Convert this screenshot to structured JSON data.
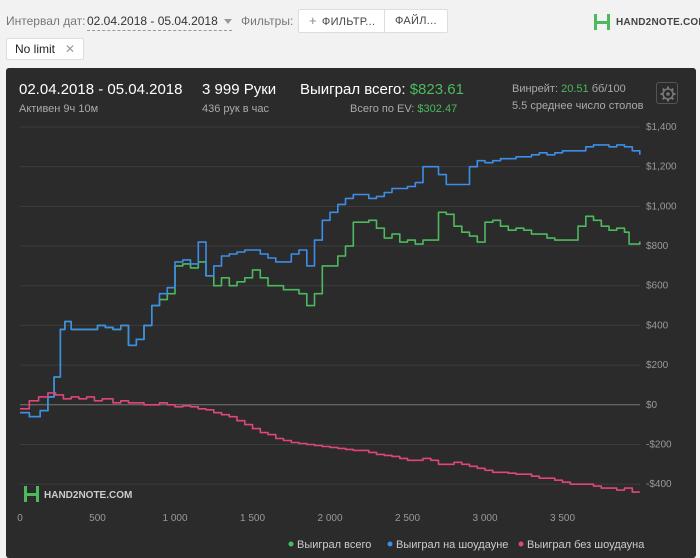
{
  "toolbar": {
    "date_label": "Интервал дат:",
    "date_value": "02.04.2018 - 05.04.2018",
    "filters_label": "Фильтры:",
    "filter_button": "ФИЛЬТР...",
    "file_button": "ФАЙЛ...",
    "chip": "No limit",
    "logo": "HAND2NOTE.COM"
  },
  "summary": {
    "date_range": "02.04.2018 - 05.04.2018",
    "active": "Активен 9ч 10м",
    "hands": "3 999 Руки",
    "hands_rate": "436 рук в час",
    "won_label": "Выиграл всего:",
    "won_value": "$823.61",
    "ev_label": "Всего по EV:",
    "ev_value": "$302.47",
    "winrate_label": "Винрейт:",
    "winrate_value": "20.51",
    "winrate_suffix": "бб/100",
    "tables": "5.5 среднее число столов"
  },
  "watermark": "HAND2NOTE.COM",
  "colors": {
    "total": "#4cb95d",
    "showdown": "#3c8ee8",
    "no_showdown": "#e0457b",
    "panel": "#2b2b2b"
  },
  "chart_data": {
    "type": "line",
    "xlabel": "",
    "ylabel": "",
    "xlim": [
      0,
      4000
    ],
    "ylim": [
      -500,
      1400
    ],
    "x_ticks": [
      0,
      500,
      1000,
      1500,
      2000,
      2500,
      3000,
      3500
    ],
    "x_tick_labels": [
      "0",
      "500",
      "1 000",
      "1 500",
      "2 000",
      "2 500",
      "3 000",
      "3 500"
    ],
    "y_ticks": [
      1400,
      1200,
      1000,
      800,
      600,
      400,
      200,
      0,
      -200,
      -400
    ],
    "y_tick_labels": [
      "$1,400",
      "$1,200",
      "$1,000",
      "$800",
      "$600",
      "$400",
      "$200",
      "$0",
      "-$200",
      "-$400"
    ],
    "legend_position": "bottom-right",
    "series": [
      {
        "name": "Выиграл всего",
        "color": "#4cb95d",
        "points": [
          [
            0,
            -40
          ],
          [
            60,
            -60
          ],
          [
            130,
            -30
          ],
          [
            180,
            40
          ],
          [
            220,
            140
          ],
          [
            260,
            380
          ],
          [
            290,
            420
          ],
          [
            330,
            380
          ],
          [
            400,
            380
          ],
          [
            500,
            400
          ],
          [
            550,
            390
          ],
          [
            600,
            380
          ],
          [
            650,
            400
          ],
          [
            700,
            300
          ],
          [
            750,
            330
          ],
          [
            800,
            400
          ],
          [
            850,
            500
          ],
          [
            900,
            530
          ],
          [
            950,
            560
          ],
          [
            1000,
            700
          ],
          [
            1050,
            710
          ],
          [
            1100,
            690
          ],
          [
            1150,
            720
          ],
          [
            1200,
            650
          ],
          [
            1250,
            600
          ],
          [
            1300,
            640
          ],
          [
            1350,
            600
          ],
          [
            1400,
            620
          ],
          [
            1450,
            640
          ],
          [
            1500,
            680
          ],
          [
            1550,
            640
          ],
          [
            1600,
            600
          ],
          [
            1650,
            600
          ],
          [
            1700,
            580
          ],
          [
            1750,
            580
          ],
          [
            1800,
            560
          ],
          [
            1850,
            500
          ],
          [
            1900,
            560
          ],
          [
            1950,
            700
          ],
          [
            2000,
            700
          ],
          [
            2050,
            750
          ],
          [
            2100,
            800
          ],
          [
            2150,
            920
          ],
          [
            2200,
            920
          ],
          [
            2250,
            930
          ],
          [
            2300,
            890
          ],
          [
            2350,
            840
          ],
          [
            2400,
            860
          ],
          [
            2450,
            820
          ],
          [
            2500,
            830
          ],
          [
            2550,
            810
          ],
          [
            2600,
            830
          ],
          [
            2650,
            830
          ],
          [
            2700,
            970
          ],
          [
            2750,
            960
          ],
          [
            2800,
            900
          ],
          [
            2850,
            870
          ],
          [
            2900,
            850
          ],
          [
            2950,
            820
          ],
          [
            3000,
            920
          ],
          [
            3050,
            930
          ],
          [
            3100,
            900
          ],
          [
            3150,
            880
          ],
          [
            3200,
            890
          ],
          [
            3250,
            880
          ],
          [
            3300,
            860
          ],
          [
            3350,
            860
          ],
          [
            3400,
            840
          ],
          [
            3450,
            830
          ],
          [
            3500,
            830
          ],
          [
            3550,
            830
          ],
          [
            3600,
            900
          ],
          [
            3650,
            950
          ],
          [
            3700,
            930
          ],
          [
            3750,
            900
          ],
          [
            3800,
            880
          ],
          [
            3850,
            890
          ],
          [
            3900,
            870
          ],
          [
            3930,
            810
          ],
          [
            3999,
            823
          ]
        ]
      },
      {
        "name": "Выиграл на шоудауне",
        "color": "#3c8ee8",
        "points": [
          [
            0,
            -40
          ],
          [
            60,
            -60
          ],
          [
            130,
            -30
          ],
          [
            180,
            40
          ],
          [
            220,
            140
          ],
          [
            260,
            380
          ],
          [
            290,
            420
          ],
          [
            330,
            380
          ],
          [
            400,
            380
          ],
          [
            500,
            400
          ],
          [
            550,
            390
          ],
          [
            600,
            380
          ],
          [
            650,
            400
          ],
          [
            700,
            300
          ],
          [
            750,
            330
          ],
          [
            800,
            400
          ],
          [
            850,
            500
          ],
          [
            900,
            560
          ],
          [
            950,
            590
          ],
          [
            1000,
            720
          ],
          [
            1050,
            730
          ],
          [
            1100,
            710
          ],
          [
            1150,
            820
          ],
          [
            1200,
            650
          ],
          [
            1250,
            700
          ],
          [
            1300,
            750
          ],
          [
            1350,
            760
          ],
          [
            1400,
            770
          ],
          [
            1450,
            780
          ],
          [
            1500,
            780
          ],
          [
            1550,
            760
          ],
          [
            1600,
            740
          ],
          [
            1650,
            720
          ],
          [
            1700,
            720
          ],
          [
            1750,
            760
          ],
          [
            1800,
            780
          ],
          [
            1850,
            700
          ],
          [
            1900,
            830
          ],
          [
            1950,
            930
          ],
          [
            2000,
            970
          ],
          [
            2050,
            1010
          ],
          [
            2100,
            1040
          ],
          [
            2150,
            1060
          ],
          [
            2200,
            1060
          ],
          [
            2250,
            1040
          ],
          [
            2300,
            1050
          ],
          [
            2350,
            1070
          ],
          [
            2400,
            1090
          ],
          [
            2450,
            1090
          ],
          [
            2500,
            1100
          ],
          [
            2550,
            1120
          ],
          [
            2600,
            1200
          ],
          [
            2650,
            1200
          ],
          [
            2700,
            1160
          ],
          [
            2750,
            1110
          ],
          [
            2800,
            1110
          ],
          [
            2850,
            1110
          ],
          [
            2900,
            1200
          ],
          [
            2950,
            1230
          ],
          [
            3000,
            1220
          ],
          [
            3050,
            1230
          ],
          [
            3100,
            1240
          ],
          [
            3150,
            1240
          ],
          [
            3200,
            1250
          ],
          [
            3250,
            1250
          ],
          [
            3300,
            1260
          ],
          [
            3350,
            1270
          ],
          [
            3400,
            1260
          ],
          [
            3450,
            1270
          ],
          [
            3500,
            1280
          ],
          [
            3550,
            1280
          ],
          [
            3600,
            1280
          ],
          [
            3650,
            1300
          ],
          [
            3700,
            1310
          ],
          [
            3750,
            1310
          ],
          [
            3800,
            1300
          ],
          [
            3850,
            1310
          ],
          [
            3900,
            1300
          ],
          [
            3950,
            1280
          ],
          [
            3999,
            1260
          ]
        ]
      },
      {
        "name": "Выиграл без шоудауна",
        "color": "#e0457b",
        "points": [
          [
            0,
            -20
          ],
          [
            60,
            20
          ],
          [
            120,
            40
          ],
          [
            180,
            60
          ],
          [
            230,
            50
          ],
          [
            280,
            30
          ],
          [
            330,
            40
          ],
          [
            380,
            30
          ],
          [
            430,
            40
          ],
          [
            480,
            20
          ],
          [
            530,
            30
          ],
          [
            600,
            10
          ],
          [
            650,
            20
          ],
          [
            700,
            10
          ],
          [
            800,
            0
          ],
          [
            900,
            10
          ],
          [
            950,
            0
          ],
          [
            1000,
            -10
          ],
          [
            1050,
            -5
          ],
          [
            1100,
            -10
          ],
          [
            1150,
            -20
          ],
          [
            1200,
            -25
          ],
          [
            1250,
            -40
          ],
          [
            1300,
            -50
          ],
          [
            1350,
            -60
          ],
          [
            1400,
            -80
          ],
          [
            1450,
            -100
          ],
          [
            1500,
            -120
          ],
          [
            1550,
            -140
          ],
          [
            1600,
            -150
          ],
          [
            1650,
            -170
          ],
          [
            1700,
            -180
          ],
          [
            1750,
            -190
          ],
          [
            1800,
            -195
          ],
          [
            1850,
            -200
          ],
          [
            1900,
            -205
          ],
          [
            1950,
            -210
          ],
          [
            2000,
            -215
          ],
          [
            2050,
            -220
          ],
          [
            2100,
            -225
          ],
          [
            2150,
            -230
          ],
          [
            2200,
            -230
          ],
          [
            2250,
            -240
          ],
          [
            2300,
            -250
          ],
          [
            2350,
            -255
          ],
          [
            2400,
            -260
          ],
          [
            2450,
            -270
          ],
          [
            2500,
            -280
          ],
          [
            2550,
            -280
          ],
          [
            2600,
            -270
          ],
          [
            2650,
            -280
          ],
          [
            2700,
            -300
          ],
          [
            2750,
            -300
          ],
          [
            2800,
            -290
          ],
          [
            2850,
            -300
          ],
          [
            2900,
            -310
          ],
          [
            2950,
            -320
          ],
          [
            3000,
            -330
          ],
          [
            3050,
            -340
          ],
          [
            3100,
            -340
          ],
          [
            3150,
            -345
          ],
          [
            3200,
            -350
          ],
          [
            3250,
            -350
          ],
          [
            3300,
            -360
          ],
          [
            3350,
            -370
          ],
          [
            3400,
            -370
          ],
          [
            3450,
            -380
          ],
          [
            3500,
            -390
          ],
          [
            3550,
            -400
          ],
          [
            3600,
            -400
          ],
          [
            3650,
            -400
          ],
          [
            3700,
            -410
          ],
          [
            3750,
            -420
          ],
          [
            3800,
            -420
          ],
          [
            3850,
            -430
          ],
          [
            3900,
            -420
          ],
          [
            3950,
            -440
          ],
          [
            3999,
            -440
          ]
        ]
      }
    ]
  }
}
